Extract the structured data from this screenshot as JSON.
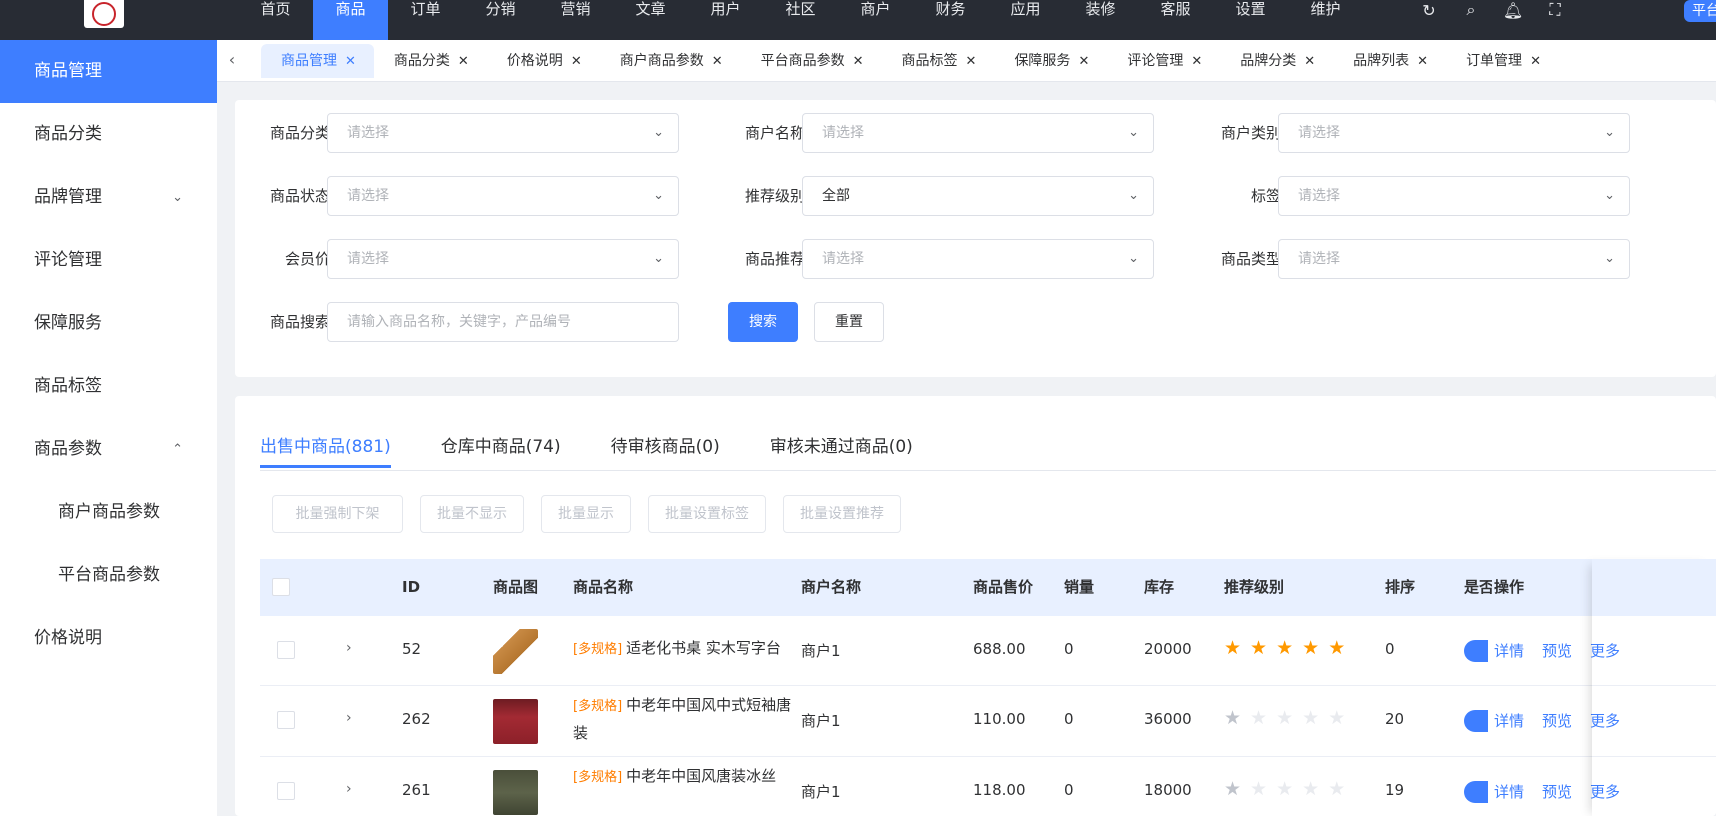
{
  "topnav": {
    "items": [
      "首页",
      "商品",
      "订单",
      "分销",
      "营销",
      "文章",
      "用户",
      "社区",
      "商户",
      "财务",
      "应用",
      "装修",
      "客服",
      "设置",
      "维护"
    ],
    "active_index": 1,
    "platform_label": "平台"
  },
  "sidebar": {
    "items": [
      {
        "label": "商品管理",
        "active": true
      },
      {
        "label": "商品分类"
      },
      {
        "label": "品牌管理",
        "arrow": "down"
      },
      {
        "label": "评论管理"
      },
      {
        "label": "保障服务"
      },
      {
        "label": "商品标签"
      },
      {
        "label": "商品参数",
        "arrow": "up"
      },
      {
        "label": "商户商品参数",
        "sub": true
      },
      {
        "label": "平台商品参数",
        "sub": true
      },
      {
        "label": "价格说明"
      }
    ]
  },
  "tabs": [
    "商品管理",
    "商品分类",
    "价格说明",
    "商户商品参数",
    "平台商品参数",
    "商品标签",
    "保障服务",
    "评论管理",
    "品牌分类",
    "品牌列表",
    "订单管理"
  ],
  "filter": {
    "category_label": "商品分类:",
    "merchant_name_label": "商户名称:",
    "merchant_type_label": "商户类别:",
    "status_label": "商品状态:",
    "recommend_level_label": "推荐级别:",
    "tag_label": "标签:",
    "member_price_label": "会员价:",
    "recommend_label": "商品推荐:",
    "product_type_label": "商品类型:",
    "search_label": "商品搜索:",
    "select_placeholder": "请选择",
    "recommend_level_value": "全部",
    "search_placeholder": "请输入商品名称，关键字，产品编号",
    "search_button": "搜索",
    "reset_button": "重置"
  },
  "sale_tabs": [
    "出售中商品(881)",
    "仓库中商品(74)",
    "待审核商品(0)",
    "审核未通过商品(0)"
  ],
  "batch_buttons": [
    "批量强制下架",
    "批量不显示",
    "批量显示",
    "批量设置标签",
    "批量设置推荐"
  ],
  "table": {
    "headers": {
      "id": "ID",
      "image": "商品图",
      "name": "商品名称",
      "merchant": "商户名称",
      "price": "商品售价",
      "sales": "销量",
      "stock": "库存",
      "level": "推荐级别",
      "sort": "排序",
      "show": "是否",
      "ops": "操作"
    },
    "rows": [
      {
        "id": "52",
        "tag": "[多规格]",
        "name": "适老化书桌 实木写字台",
        "merchant": "商户1",
        "price": "688.00",
        "sales": "0",
        "stock": "20000",
        "stars": 5,
        "sort": "0"
      },
      {
        "id": "262",
        "tag": "[多规格]",
        "name": "中老年中国风中式短袖唐装",
        "merchant": "商户1",
        "price": "110.00",
        "sales": "0",
        "stock": "36000",
        "stars": 1,
        "sort": "20"
      },
      {
        "id": "261",
        "tag": "[多规格]",
        "name": "中老年中国风唐装冰丝",
        "merchant": "商户1",
        "price": "118.00",
        "sales": "0",
        "stock": "18000",
        "stars": 1,
        "sort": "19"
      }
    ],
    "op_labels": [
      "详情",
      "预览",
      "更多"
    ]
  },
  "colors": {
    "primary": "#3e7eff",
    "topbar": "#282c34",
    "star": "#ff9900",
    "tag": "#ff7d00"
  },
  "icons": [
    "refresh-icon",
    "search-icon",
    "bell-icon",
    "fullscreen-icon",
    "chevron-left-icon",
    "close-icon",
    "chevron-down-icon",
    "chevron-up-icon",
    "chevron-right-icon",
    "star-icon"
  ]
}
